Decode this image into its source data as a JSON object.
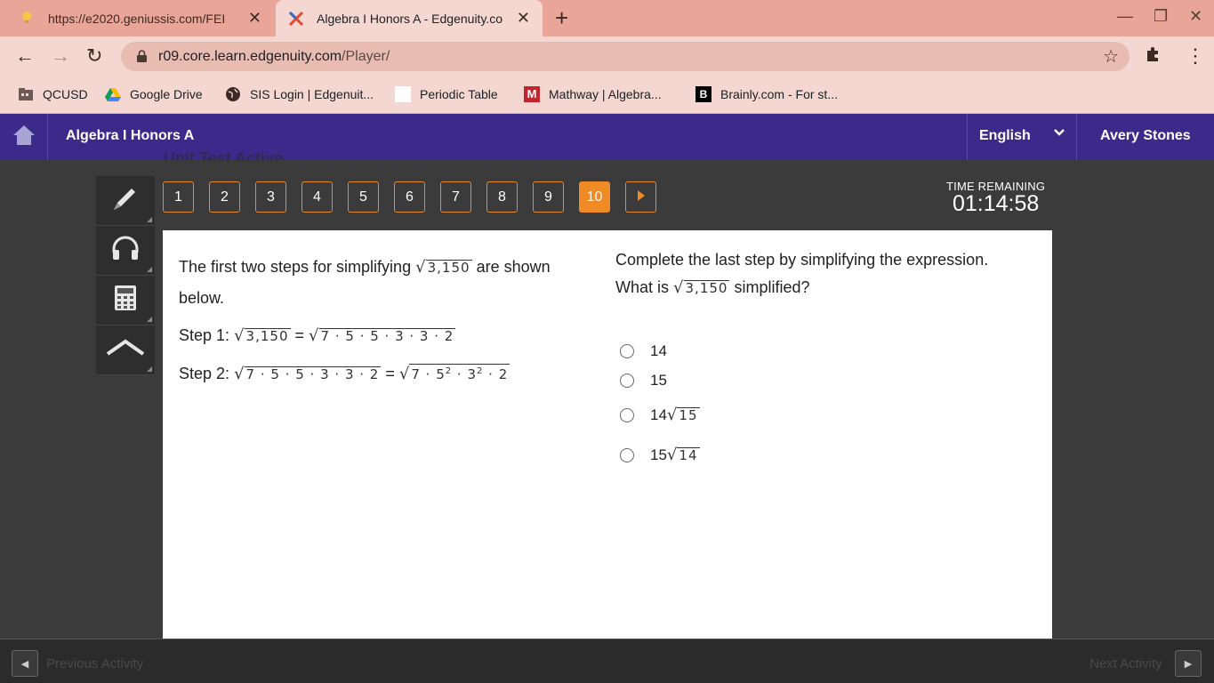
{
  "browser": {
    "tabs": [
      {
        "title": "https://e2020.geniussis.com/FEI",
        "active": false
      },
      {
        "title": "Algebra I Honors A - Edgenuity.co",
        "active": true
      }
    ],
    "url_host": "r09.core.learn.edgenuity.com",
    "url_path": "/Player/",
    "bookmarks": [
      "QCUSD",
      "Google Drive",
      "SIS Login | Edgenuit...",
      "Periodic Table",
      "Mathway | Algebra...",
      "Brainly.com - For st..."
    ]
  },
  "app": {
    "course_title": "Algebra I Honors A",
    "language": "English",
    "user": "Avery Stones",
    "peek_text": "Unit Test     Active"
  },
  "tools": [
    "pencil-icon",
    "headphones-icon",
    "calculator-icon",
    "formula-icon"
  ],
  "questions": [
    "1",
    "2",
    "3",
    "4",
    "5",
    "6",
    "7",
    "8",
    "9",
    "10"
  ],
  "current_question": "10",
  "timer": {
    "label": "TIME REMAINING",
    "value": "01:14:58"
  },
  "question": {
    "intro_pre": "The first two steps for simplifying",
    "radicand": "3,150",
    "intro_post": "are shown below.",
    "step1_label": "Step 1:",
    "step1_rhs": "7 · 5 · 5 · 3 · 3 · 2",
    "step2_label": "Step 2:",
    "step2_lhs": "7 · 5 · 5 · 3 · 3 · 2",
    "step2_rhs_a": "7 · 5",
    "exp2": "2",
    "step2_rhs_b": " · 3",
    "step2_rhs_c": " · 2",
    "equals": "=",
    "prompt_line1": "Complete the last step by simplifying the expression.",
    "prompt_pre": "What is",
    "prompt_post": "simplified?",
    "options": [
      {
        "coef": "14",
        "rad": ""
      },
      {
        "coef": "15",
        "rad": ""
      },
      {
        "coef": "14",
        "rad": "15"
      },
      {
        "coef": "15",
        "rad": "14"
      }
    ]
  },
  "footer": {
    "prev": "Previous Activity",
    "next": "Next Activity"
  }
}
